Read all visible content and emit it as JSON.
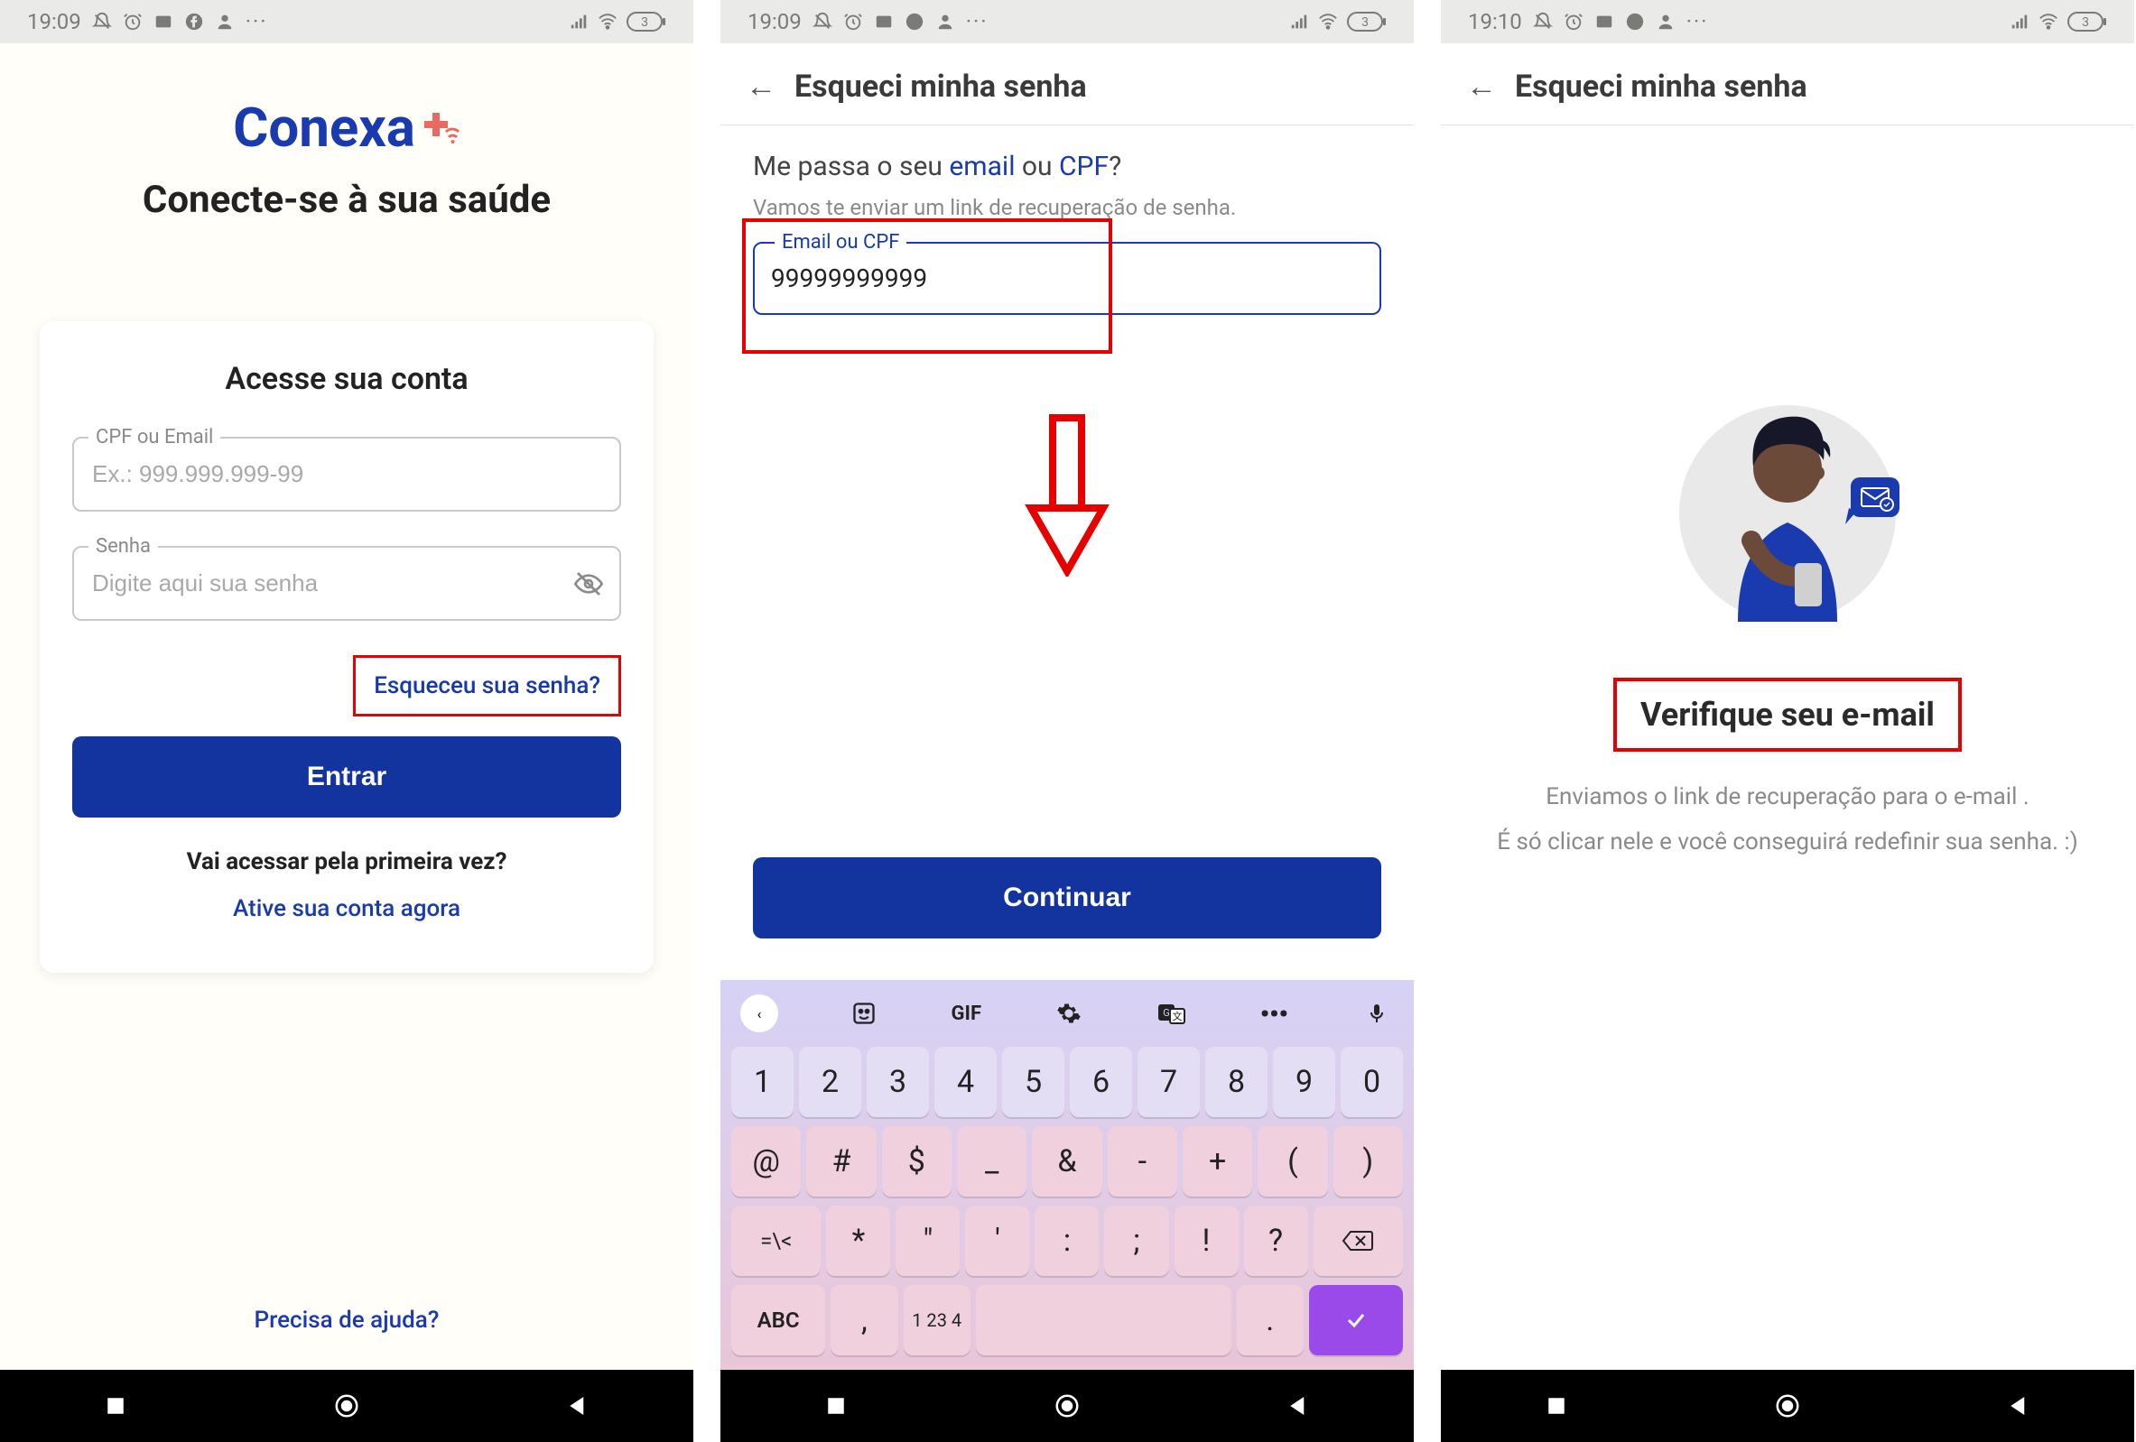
{
  "status": {
    "time1": "19:09",
    "time2": "19:09",
    "time3": "19:10",
    "battery": "3"
  },
  "screen1": {
    "brand": "Conexa",
    "tagline": "Conecte-se à sua saúde",
    "card_title": "Acesse sua conta",
    "cpf_label": "CPF ou Email",
    "cpf_placeholder": "Ex.: 999.999.999-99",
    "pwd_label": "Senha",
    "pwd_placeholder": "Digite aqui sua senha",
    "forgot": "Esqueceu sua senha?",
    "enter": "Entrar",
    "first_time": "Vai acessar pela primeira vez?",
    "activate": "Ative sua conta agora",
    "help": "Precisa de ajuda?"
  },
  "screen2": {
    "header": "Esqueci minha senha",
    "prompt_pre": "Me passa o seu ",
    "prompt_email": "email",
    "prompt_mid": " ou ",
    "prompt_cpf": "CPF",
    "prompt_post": "?",
    "subline": "Vamos te enviar um link de recuperação de senha.",
    "field_label": "Email ou CPF",
    "field_value": "99999999999",
    "continue": "Continuar"
  },
  "keyboard": {
    "toolbar": {
      "gif": "GIF"
    },
    "row1": [
      "1",
      "2",
      "3",
      "4",
      "5",
      "6",
      "7",
      "8",
      "9",
      "0"
    ],
    "row2": [
      "@",
      "#",
      "$",
      "_",
      "&",
      "-",
      "+",
      "(",
      ")"
    ],
    "row3_left": "=\\<",
    "row3": [
      "*",
      "\"",
      "'",
      ":",
      ";",
      "!",
      "?"
    ],
    "abc": "ABC",
    "numkey_top": "1 2",
    "numkey_bot": "3 4",
    "comma": ",",
    "dot": "."
  },
  "screen3": {
    "header": "Esqueci minha senha",
    "heading": "Verifique seu e-mail",
    "sub1": "Enviamos o link de recuperação para o e-mail .",
    "sub2": "É só clicar nele e você conseguirá redefinir sua senha. :)"
  }
}
